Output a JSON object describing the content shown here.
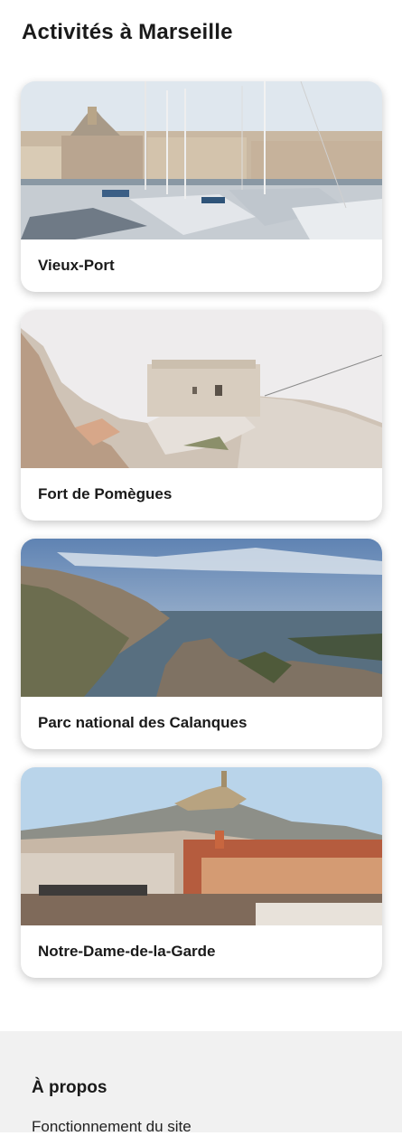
{
  "page": {
    "title": "Activités à Marseille"
  },
  "activities": [
    {
      "label": "Vieux-Port",
      "image": "harbor-photo"
    },
    {
      "label": "Fort de Pomègues",
      "image": "fort-photo"
    },
    {
      "label": "Parc national des Calanques",
      "image": "calanques-photo"
    },
    {
      "label": "Notre-Dame-de-la-Garde",
      "image": "basilica-photo"
    }
  ],
  "footer": {
    "heading": "À propos",
    "link": "Fonctionnement du site"
  }
}
